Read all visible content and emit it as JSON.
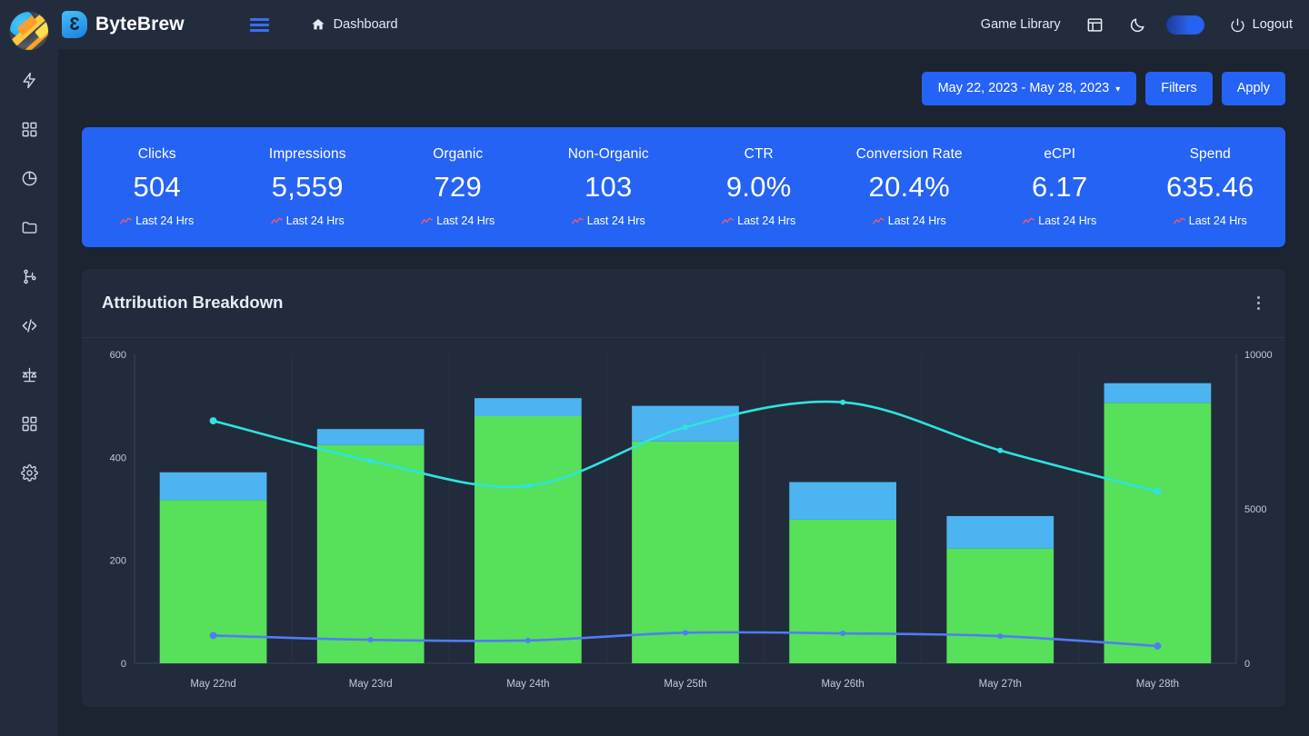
{
  "app": {
    "brand": "ByteBrew",
    "brand_glyph": "3"
  },
  "header": {
    "menu_icon": "hamburger-icon",
    "dashboard_label": "Dashboard",
    "dashboard_icon": "home-icon",
    "game_library_label": "Game Library",
    "layout_icon": "layout-panel-icon",
    "theme_icon": "moon-icon",
    "theme_toggle_state": "on",
    "logout_label": "Logout",
    "logout_icon": "power-icon"
  },
  "sidebar": {
    "avatar": "user-avatar",
    "items": [
      {
        "icon": "bolt-icon",
        "name": "sidebar-item-bolt"
      },
      {
        "icon": "grid-icon",
        "name": "sidebar-item-grid"
      },
      {
        "icon": "pie-chart-icon",
        "name": "sidebar-item-pie-chart"
      },
      {
        "icon": "folder-icon",
        "name": "sidebar-item-folder"
      },
      {
        "icon": "branch-icon",
        "name": "sidebar-item-branch"
      },
      {
        "icon": "code-icon",
        "name": "sidebar-item-code"
      },
      {
        "icon": "scales-icon",
        "name": "sidebar-item-scales"
      },
      {
        "icon": "grid-icon",
        "name": "sidebar-item-grid-2"
      },
      {
        "icon": "gear-icon",
        "name": "sidebar-item-settings"
      }
    ]
  },
  "toolbar": {
    "date_range": "May 22, 2023 - May 28, 2023",
    "date_caret": "▾",
    "filters_label": "Filters",
    "apply_label": "Apply"
  },
  "kpis": [
    {
      "label": "Clicks",
      "value": "504",
      "sub": "Last 24 Hrs"
    },
    {
      "label": "Impressions",
      "value": "5,559",
      "sub": "Last 24 Hrs"
    },
    {
      "label": "Organic",
      "value": "729",
      "sub": "Last 24 Hrs"
    },
    {
      "label": "Non-Organic",
      "value": "103",
      "sub": "Last 24 Hrs"
    },
    {
      "label": "CTR",
      "value": "9.0%",
      "sub": "Last 24 Hrs"
    },
    {
      "label": "Conversion Rate",
      "value": "20.4%",
      "sub": "Last 24 Hrs"
    },
    {
      "label": "eCPI",
      "value": "6.17",
      "sub": "Last 24 Hrs"
    },
    {
      "label": "Spend",
      "value": "635.46",
      "sub": "Last 24 Hrs"
    }
  ],
  "chart_card": {
    "title": "Attribution Breakdown",
    "menu_icon": "kebab-menu-icon"
  },
  "chart_data": {
    "type": "bar",
    "title": "Attribution Breakdown",
    "categories": [
      "May 22nd",
      "May 23rd",
      "May 24th",
      "May 25th",
      "May 26th",
      "May 27th",
      "May 28th"
    ],
    "stacked": true,
    "grid": false,
    "legend": "none",
    "xlabel": "",
    "ylabel": "",
    "ylim": [
      0,
      600
    ],
    "yticks": [
      0,
      200,
      400,
      600
    ],
    "y2lim": [
      0,
      10000
    ],
    "y2ticks": [
      0,
      5000,
      10000
    ],
    "series": [
      {
        "name": "Organic",
        "type": "bar",
        "axis": "left",
        "color": "#57e05a",
        "values": [
          317,
          424,
          480,
          431,
          279,
          223,
          506
        ]
      },
      {
        "name": "Non-Organic",
        "type": "bar",
        "axis": "left",
        "color": "#4cb4f0",
        "values": [
          54,
          31,
          35,
          69,
          73,
          63,
          38
        ]
      },
      {
        "name": "Impressions",
        "type": "line",
        "axis": "right",
        "color": "#2fe3e0",
        "values": [
          7850,
          6550,
          5740,
          7640,
          8450,
          6890,
          5560
        ]
      },
      {
        "name": "Clicks",
        "type": "line",
        "axis": "right",
        "color": "#4f7df5",
        "values": [
          900,
          760,
          740,
          990,
          970,
          880,
          560
        ]
      }
    ]
  },
  "colors": {
    "accent": "#2563f5",
    "panel": "#222b3b",
    "page_bg": "#1c2331",
    "topbar": "#232c3d",
    "bar_green": "#57e05a",
    "bar_blue": "#4cb4f0",
    "line_cyan": "#2fe3e0",
    "line_blue": "#4f7df5"
  }
}
